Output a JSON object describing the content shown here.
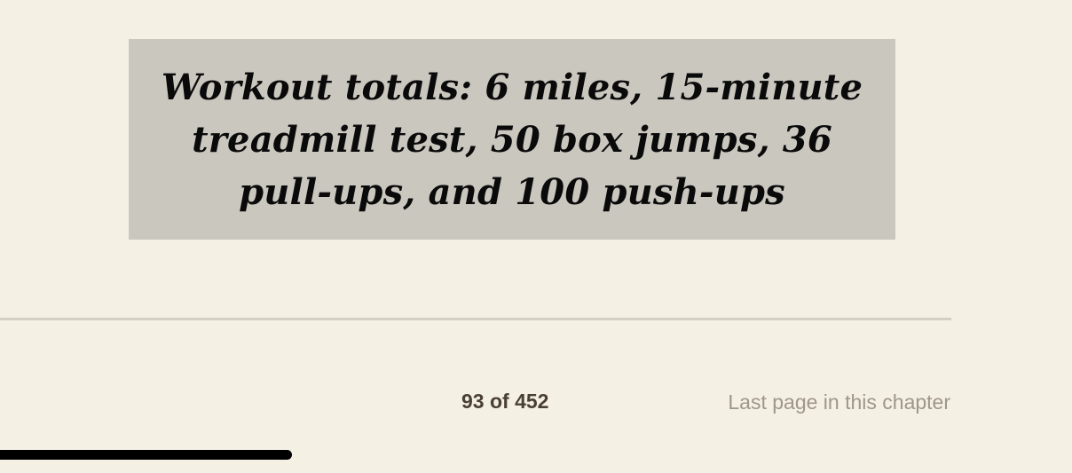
{
  "callout": {
    "text": "Workout totals: 6 miles, 15-minute treadmill test, 50 box jumps, 36 pull-ups, and 100 push-ups"
  },
  "footer": {
    "page_counter": "93 of 452",
    "chapter_note": "Last page in this chapter"
  },
  "home_indicator": {
    "fill_fraction": 0.272
  },
  "colors": {
    "background": "#f4f0e4",
    "callout_background": "#cac7bf",
    "callout_text": "#0a0a0a",
    "page_counter_text": "#4a3f33",
    "chapter_note_text": "#9f9688",
    "divider": "#d3cfc5",
    "indicator": "#000000"
  }
}
